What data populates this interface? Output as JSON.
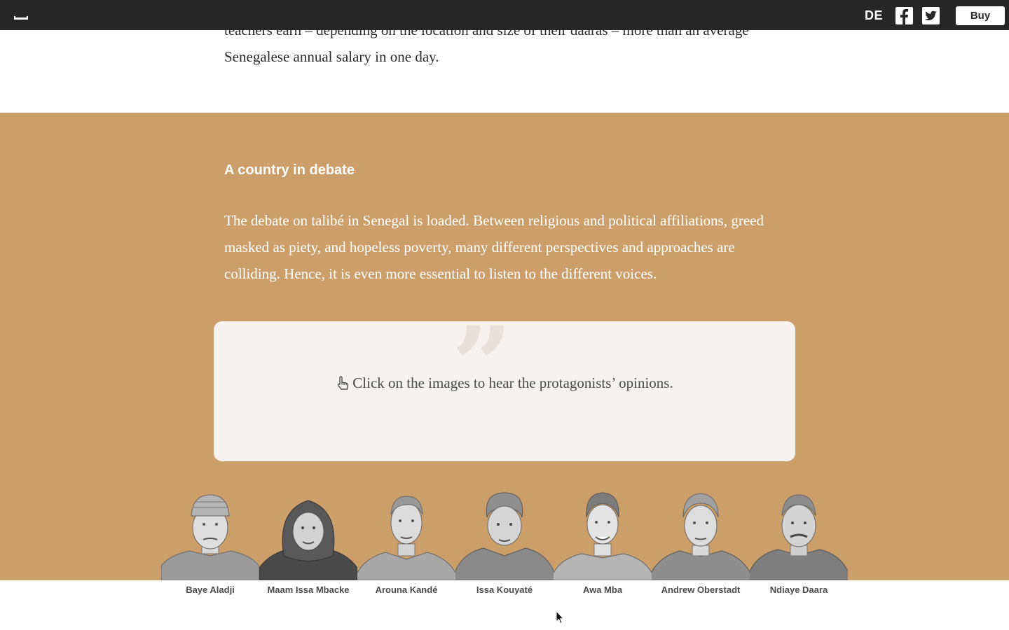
{
  "topbar": {
    "menu_icon": "menu-icon",
    "language": "DE",
    "facebook_icon": "facebook-icon",
    "twitter_icon": "twitter-icon",
    "buy_label": "Buy"
  },
  "intro": {
    "text": "teachers earn – depending on the location and size of their daaras – more than an average Senegalese annual salary in one day."
  },
  "debate": {
    "title": "A country in debate",
    "body": "The debate on talibé in Senegal is loaded. Between religious and political affiliations, greed masked as piety, and hopeless poverty, many different perspectives and approaches are colliding. Hence, it is even more essential to listen to the different voices.",
    "quote_mark": "”",
    "prompt": "Click on the images to hear the protagonists’ opinions.",
    "prompt_icon": "pointing-hand-icon"
  },
  "people": [
    {
      "name": "Baye Aladji"
    },
    {
      "name": "Maam Issa Mbacke"
    },
    {
      "name": "Arouna Kandé"
    },
    {
      "name": "Issa Kouyaté"
    },
    {
      "name": "Awa Mba"
    },
    {
      "name": "Andrew Oberstadt"
    },
    {
      "name": "Ndiaye Daara"
    }
  ],
  "colors": {
    "topbar": "#262626",
    "section_background": "#cc9e6a",
    "quote_box": "#f5f2ef"
  }
}
